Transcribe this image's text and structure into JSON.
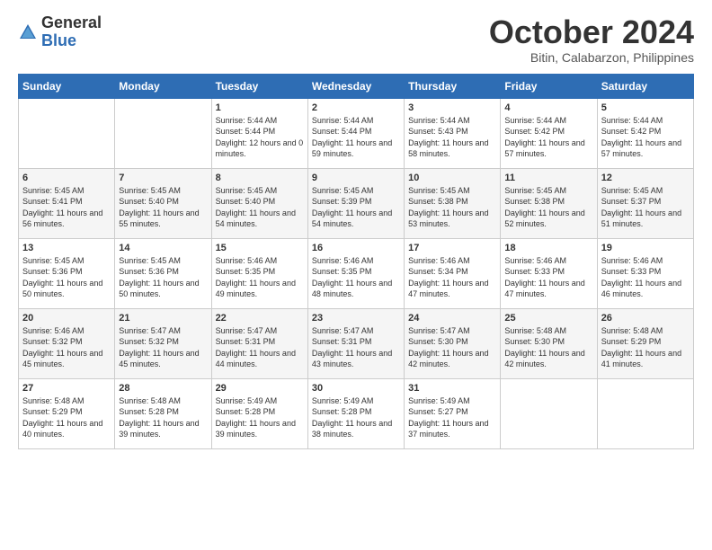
{
  "logo": {
    "general": "General",
    "blue": "Blue"
  },
  "header": {
    "month": "October 2024",
    "location": "Bitin, Calabarzon, Philippines"
  },
  "days": [
    "Sunday",
    "Monday",
    "Tuesday",
    "Wednesday",
    "Thursday",
    "Friday",
    "Saturday"
  ],
  "weeks": [
    [
      {
        "day": "",
        "sunrise": "",
        "sunset": "",
        "daylight": ""
      },
      {
        "day": "",
        "sunrise": "",
        "sunset": "",
        "daylight": ""
      },
      {
        "day": "1",
        "sunrise": "Sunrise: 5:44 AM",
        "sunset": "Sunset: 5:44 PM",
        "daylight": "Daylight: 12 hours and 0 minutes."
      },
      {
        "day": "2",
        "sunrise": "Sunrise: 5:44 AM",
        "sunset": "Sunset: 5:44 PM",
        "daylight": "Daylight: 11 hours and 59 minutes."
      },
      {
        "day": "3",
        "sunrise": "Sunrise: 5:44 AM",
        "sunset": "Sunset: 5:43 PM",
        "daylight": "Daylight: 11 hours and 58 minutes."
      },
      {
        "day": "4",
        "sunrise": "Sunrise: 5:44 AM",
        "sunset": "Sunset: 5:42 PM",
        "daylight": "Daylight: 11 hours and 57 minutes."
      },
      {
        "day": "5",
        "sunrise": "Sunrise: 5:44 AM",
        "sunset": "Sunset: 5:42 PM",
        "daylight": "Daylight: 11 hours and 57 minutes."
      }
    ],
    [
      {
        "day": "6",
        "sunrise": "Sunrise: 5:45 AM",
        "sunset": "Sunset: 5:41 PM",
        "daylight": "Daylight: 11 hours and 56 minutes."
      },
      {
        "day": "7",
        "sunrise": "Sunrise: 5:45 AM",
        "sunset": "Sunset: 5:40 PM",
        "daylight": "Daylight: 11 hours and 55 minutes."
      },
      {
        "day": "8",
        "sunrise": "Sunrise: 5:45 AM",
        "sunset": "Sunset: 5:40 PM",
        "daylight": "Daylight: 11 hours and 54 minutes."
      },
      {
        "day": "9",
        "sunrise": "Sunrise: 5:45 AM",
        "sunset": "Sunset: 5:39 PM",
        "daylight": "Daylight: 11 hours and 54 minutes."
      },
      {
        "day": "10",
        "sunrise": "Sunrise: 5:45 AM",
        "sunset": "Sunset: 5:38 PM",
        "daylight": "Daylight: 11 hours and 53 minutes."
      },
      {
        "day": "11",
        "sunrise": "Sunrise: 5:45 AM",
        "sunset": "Sunset: 5:38 PM",
        "daylight": "Daylight: 11 hours and 52 minutes."
      },
      {
        "day": "12",
        "sunrise": "Sunrise: 5:45 AM",
        "sunset": "Sunset: 5:37 PM",
        "daylight": "Daylight: 11 hours and 51 minutes."
      }
    ],
    [
      {
        "day": "13",
        "sunrise": "Sunrise: 5:45 AM",
        "sunset": "Sunset: 5:36 PM",
        "daylight": "Daylight: 11 hours and 50 minutes."
      },
      {
        "day": "14",
        "sunrise": "Sunrise: 5:45 AM",
        "sunset": "Sunset: 5:36 PM",
        "daylight": "Daylight: 11 hours and 50 minutes."
      },
      {
        "day": "15",
        "sunrise": "Sunrise: 5:46 AM",
        "sunset": "Sunset: 5:35 PM",
        "daylight": "Daylight: 11 hours and 49 minutes."
      },
      {
        "day": "16",
        "sunrise": "Sunrise: 5:46 AM",
        "sunset": "Sunset: 5:35 PM",
        "daylight": "Daylight: 11 hours and 48 minutes."
      },
      {
        "day": "17",
        "sunrise": "Sunrise: 5:46 AM",
        "sunset": "Sunset: 5:34 PM",
        "daylight": "Daylight: 11 hours and 47 minutes."
      },
      {
        "day": "18",
        "sunrise": "Sunrise: 5:46 AM",
        "sunset": "Sunset: 5:33 PM",
        "daylight": "Daylight: 11 hours and 47 minutes."
      },
      {
        "day": "19",
        "sunrise": "Sunrise: 5:46 AM",
        "sunset": "Sunset: 5:33 PM",
        "daylight": "Daylight: 11 hours and 46 minutes."
      }
    ],
    [
      {
        "day": "20",
        "sunrise": "Sunrise: 5:46 AM",
        "sunset": "Sunset: 5:32 PM",
        "daylight": "Daylight: 11 hours and 45 minutes."
      },
      {
        "day": "21",
        "sunrise": "Sunrise: 5:47 AM",
        "sunset": "Sunset: 5:32 PM",
        "daylight": "Daylight: 11 hours and 45 minutes."
      },
      {
        "day": "22",
        "sunrise": "Sunrise: 5:47 AM",
        "sunset": "Sunset: 5:31 PM",
        "daylight": "Daylight: 11 hours and 44 minutes."
      },
      {
        "day": "23",
        "sunrise": "Sunrise: 5:47 AM",
        "sunset": "Sunset: 5:31 PM",
        "daylight": "Daylight: 11 hours and 43 minutes."
      },
      {
        "day": "24",
        "sunrise": "Sunrise: 5:47 AM",
        "sunset": "Sunset: 5:30 PM",
        "daylight": "Daylight: 11 hours and 42 minutes."
      },
      {
        "day": "25",
        "sunrise": "Sunrise: 5:48 AM",
        "sunset": "Sunset: 5:30 PM",
        "daylight": "Daylight: 11 hours and 42 minutes."
      },
      {
        "day": "26",
        "sunrise": "Sunrise: 5:48 AM",
        "sunset": "Sunset: 5:29 PM",
        "daylight": "Daylight: 11 hours and 41 minutes."
      }
    ],
    [
      {
        "day": "27",
        "sunrise": "Sunrise: 5:48 AM",
        "sunset": "Sunset: 5:29 PM",
        "daylight": "Daylight: 11 hours and 40 minutes."
      },
      {
        "day": "28",
        "sunrise": "Sunrise: 5:48 AM",
        "sunset": "Sunset: 5:28 PM",
        "daylight": "Daylight: 11 hours and 39 minutes."
      },
      {
        "day": "29",
        "sunrise": "Sunrise: 5:49 AM",
        "sunset": "Sunset: 5:28 PM",
        "daylight": "Daylight: 11 hours and 39 minutes."
      },
      {
        "day": "30",
        "sunrise": "Sunrise: 5:49 AM",
        "sunset": "Sunset: 5:28 PM",
        "daylight": "Daylight: 11 hours and 38 minutes."
      },
      {
        "day": "31",
        "sunrise": "Sunrise: 5:49 AM",
        "sunset": "Sunset: 5:27 PM",
        "daylight": "Daylight: 11 hours and 37 minutes."
      },
      {
        "day": "",
        "sunrise": "",
        "sunset": "",
        "daylight": ""
      },
      {
        "day": "",
        "sunrise": "",
        "sunset": "",
        "daylight": ""
      }
    ]
  ]
}
